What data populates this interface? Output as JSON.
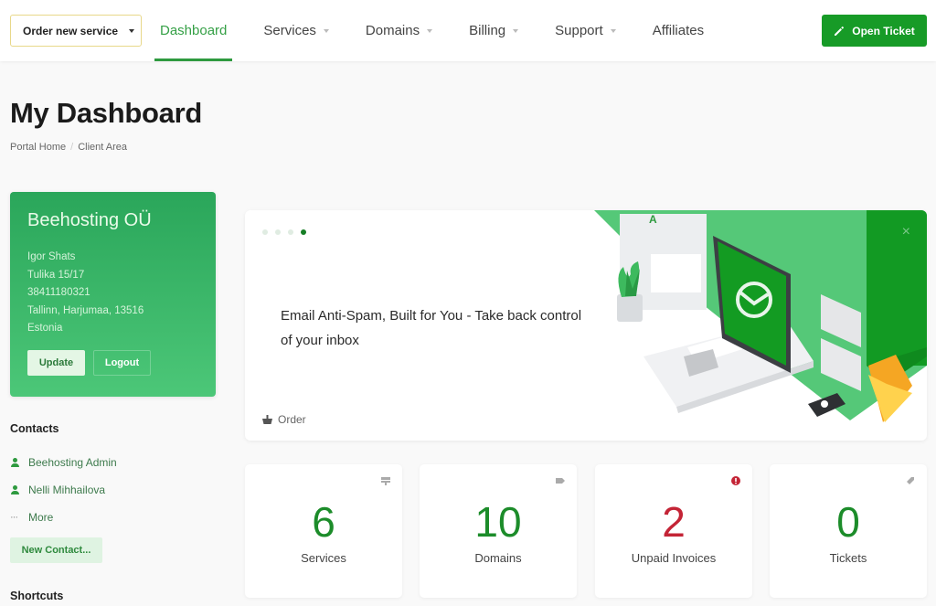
{
  "header": {
    "order_button": "Order new service",
    "nav": [
      {
        "label": "Dashboard",
        "active": true,
        "dropdown": false
      },
      {
        "label": "Services",
        "active": false,
        "dropdown": true
      },
      {
        "label": "Domains",
        "active": false,
        "dropdown": true
      },
      {
        "label": "Billing",
        "active": false,
        "dropdown": true
      },
      {
        "label": "Support",
        "active": false,
        "dropdown": true
      },
      {
        "label": "Affiliates",
        "active": false,
        "dropdown": false
      }
    ],
    "open_ticket": "Open Ticket"
  },
  "page": {
    "title": "My Dashboard",
    "breadcrumb": [
      "Portal Home",
      "Client Area"
    ]
  },
  "client": {
    "company": "Beehosting OÜ",
    "lines": [
      "Igor Shats",
      "Tulika 15/17",
      "38411180321",
      "Tallinn, Harjumaa, 13516",
      "Estonia"
    ],
    "update_label": "Update",
    "logout_label": "Logout"
  },
  "contacts": {
    "title": "Contacts",
    "items": [
      "Beehosting Admin",
      "Nelli Mihhailova"
    ],
    "more_label": "More",
    "new_contact_label": "New Contact..."
  },
  "shortcuts": {
    "title": "Shortcuts"
  },
  "promo": {
    "slides_total": 4,
    "active_slide": 4,
    "text": "Email Anti-Spam, Built for You - Take back control of your inbox",
    "order_label": "Order",
    "close_icon": "×"
  },
  "stats": [
    {
      "value": "6",
      "label": "Services",
      "icon": "server-icon",
      "status": "normal"
    },
    {
      "value": "10",
      "label": "Domains",
      "icon": "tag-icon",
      "status": "normal"
    },
    {
      "value": "2",
      "label": "Unpaid Invoices",
      "icon": "alert-icon",
      "status": "danger"
    },
    {
      "value": "0",
      "label": "Tickets",
      "icon": "ticket-icon",
      "status": "normal"
    }
  ],
  "colors": {
    "brand_green": "#179b27",
    "nav_active": "#35a046",
    "danger": "#c42436"
  }
}
